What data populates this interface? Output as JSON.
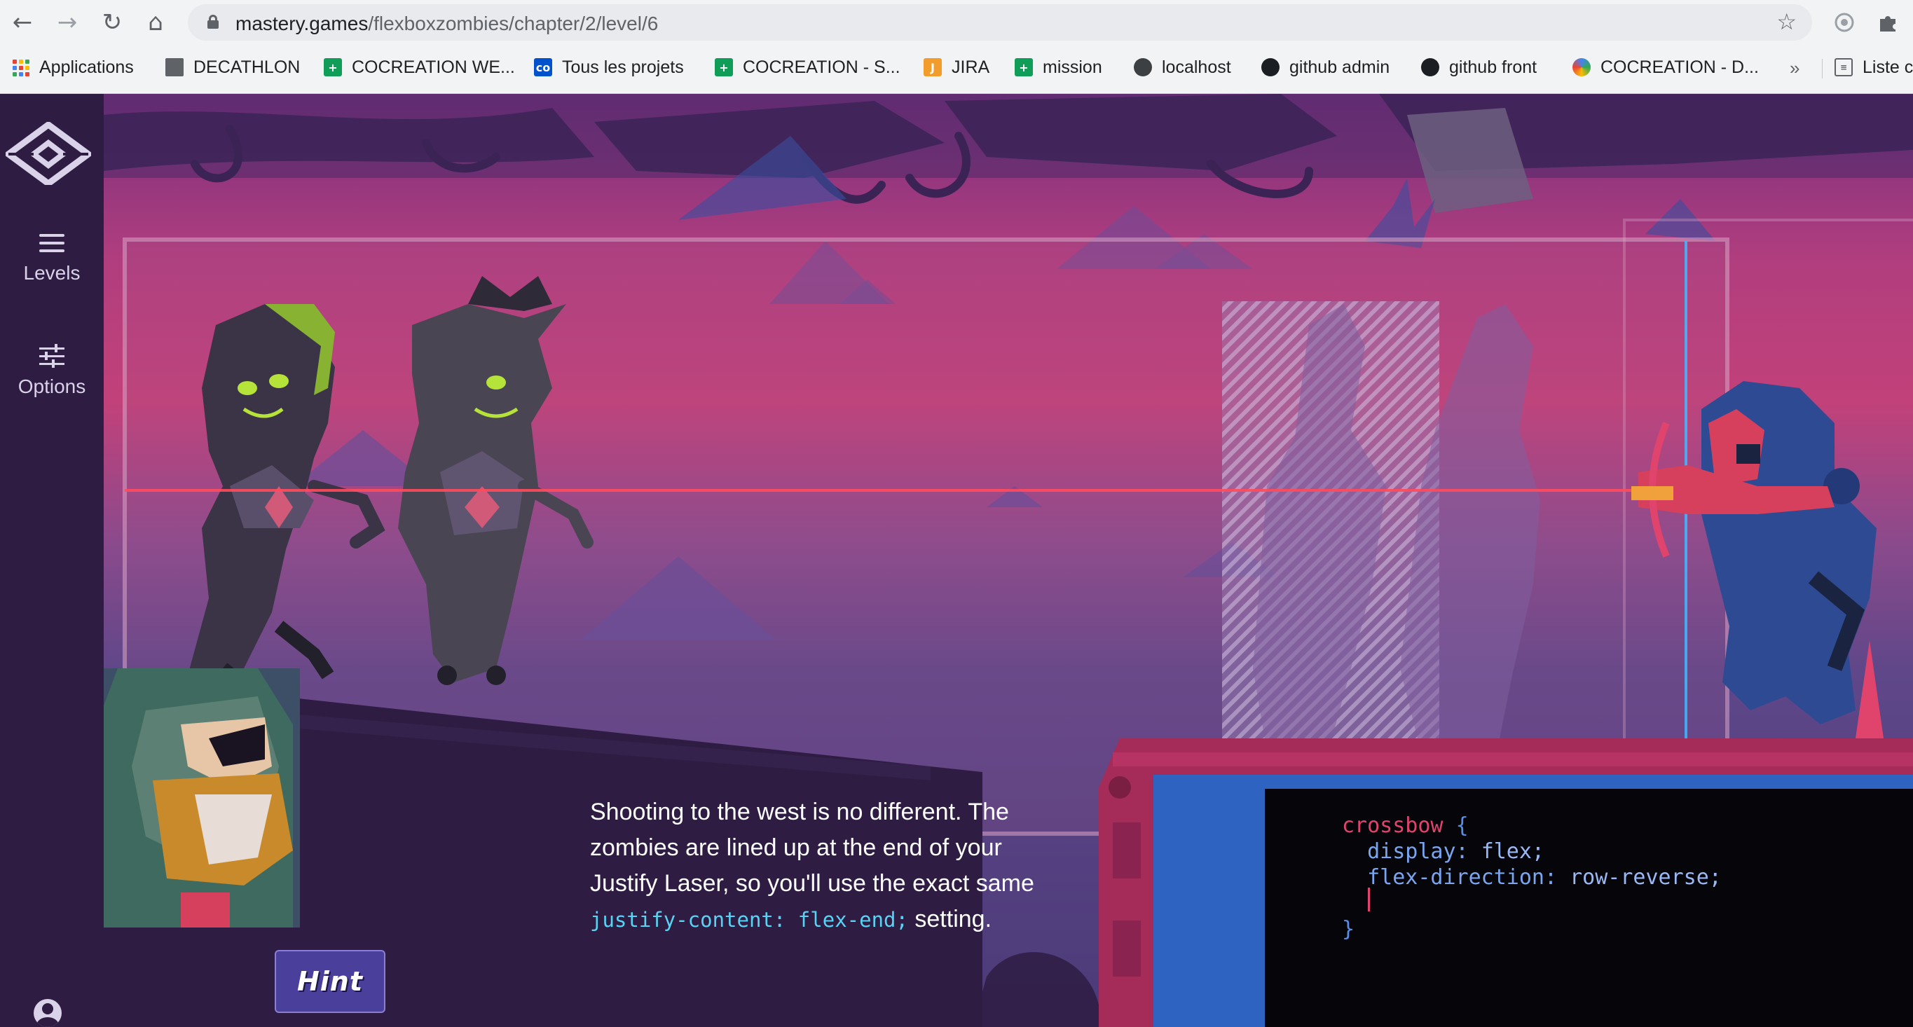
{
  "browser": {
    "url_host": "mastery.games",
    "url_path": "/flexboxzombies/chapter/2/level/6",
    "nav_icons": [
      "back-icon",
      "forward-icon",
      "reload-icon",
      "home-icon"
    ],
    "bookmarks": [
      {
        "label": "Applications",
        "icon": "apps-icon"
      },
      {
        "label": "DECATHLON",
        "icon": "folder-icon"
      },
      {
        "label": "COCREATION WE...",
        "icon": "sheets-icon"
      },
      {
        "label": "Tous les projets",
        "icon": "co-icon",
        "icon_text": "co"
      },
      {
        "label": "COCREATION - S...",
        "icon": "sheets-icon"
      },
      {
        "label": "JIRA",
        "icon": "jira-icon",
        "icon_text": "J"
      },
      {
        "label": "mission",
        "icon": "sheets-icon"
      },
      {
        "label": "localhost",
        "icon": "globe-icon"
      },
      {
        "label": "github admin",
        "icon": "github-icon"
      },
      {
        "label": "github front",
        "icon": "github-icon"
      },
      {
        "label": "COCREATION - D...",
        "icon": "cocreation-icon"
      }
    ],
    "more_label": "»",
    "reading_list_label": "Liste c"
  },
  "sidebar": {
    "levels_label": "Levels",
    "options_label": "Options"
  },
  "dialogue": {
    "text_before": "Shooting to the west is no different. The zombies are lined up at the end of your Justify Laser, so you'll use the exact same ",
    "code_snippet": "justify-content: flex-end;",
    "text_after": " setting."
  },
  "hint_label": "Hint",
  "editor": {
    "selector": "crossbow",
    "open_brace": "{",
    "close_brace": "}",
    "line1_prop": "display:",
    "line1_val": "flex;",
    "line2_prop": "flex-direction:",
    "line2_val": "row-reverse;"
  },
  "colors": {
    "sidebar_bg": "#2e1c43",
    "sky_pink": "#c2417a",
    "ground_purple": "#5d4487",
    "laser_red": "#ff4b5c",
    "hint_button": "#4a3f9a",
    "code_selector": "#e0446d",
    "code_keyword": "#7aa6f0",
    "code_inline": "#58d3f3"
  }
}
